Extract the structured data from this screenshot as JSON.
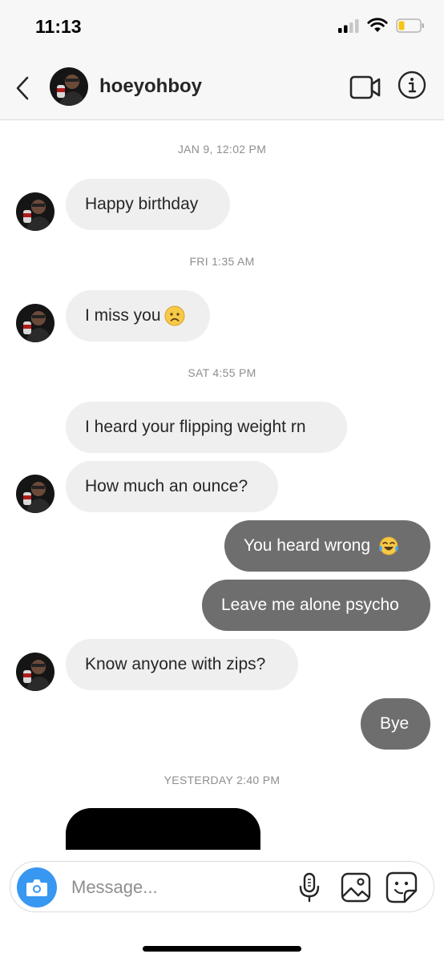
{
  "status_bar": {
    "time": "11:13"
  },
  "header": {
    "username": "hoeyohboy"
  },
  "messages": {
    "ts1": "JAN 9, 12:02 PM",
    "m1": "Happy birthday",
    "ts2": "FRI 1:35 AM",
    "m2": "I miss you",
    "ts3": "SAT 4:55 PM",
    "m3": "I heard your flipping weight rn",
    "m4": "How much an ounce?",
    "m5": "You heard wrong",
    "m6": "Leave me alone psycho",
    "m7": "Know anyone with zips?",
    "m8": "Bye",
    "ts4": "YESTERDAY 2:40 PM"
  },
  "composer": {
    "placeholder": "Message..."
  },
  "icons": {
    "back": "chevron-left-icon",
    "video": "video-camera-icon",
    "info": "info-icon",
    "camera": "camera-icon",
    "mic": "microphone-icon",
    "gallery": "image-icon",
    "sticker": "sticker-icon",
    "sad_emoji": "slightly-frowning-face-emoji",
    "laugh_emoji": "tears-of-joy-emoji"
  },
  "colors": {
    "accent": "#3897f0",
    "incoming_bubble": "#efefef",
    "outgoing_bubble": "#6e6e6e",
    "timestamp": "#8e8e8e",
    "battery": "#f5c518"
  }
}
